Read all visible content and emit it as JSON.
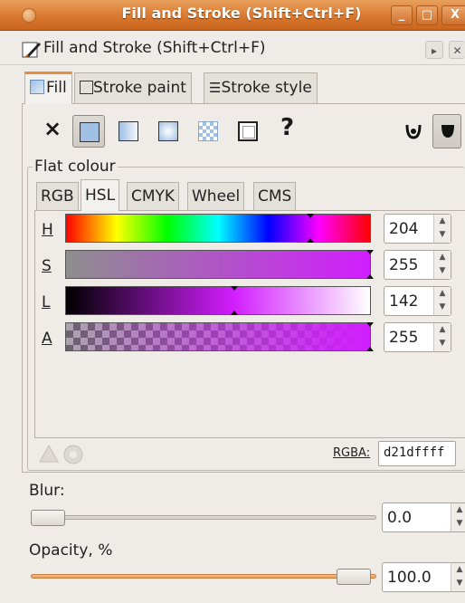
{
  "window": {
    "title": "Fill and Stroke (Shift+Ctrl+F)",
    "buttons": [
      "_",
      "□",
      "X"
    ]
  },
  "dock": {
    "title": "Fill and Stroke (Shift+Ctrl+F)"
  },
  "tabs": [
    {
      "label": "Fill",
      "active": true
    },
    {
      "label": "Stroke paint",
      "active": false
    },
    {
      "label": "Stroke style",
      "active": false
    }
  ],
  "paint_types": [
    {
      "icon": "no-paint-icon",
      "glyph": "×"
    },
    {
      "icon": "flat-color-icon",
      "selected": true
    },
    {
      "icon": "linear-gradient-icon"
    },
    {
      "icon": "radial-gradient-icon"
    },
    {
      "icon": "pattern-icon"
    },
    {
      "icon": "swatch-icon"
    },
    {
      "icon": "unset-paint-icon",
      "glyph": "?"
    }
  ],
  "fill_rule": {
    "evenodd": "evenodd-icon",
    "nonzero": "nonzero-icon"
  },
  "frame": {
    "label": "Flat colour"
  },
  "color_tabs": [
    {
      "label": "RGB"
    },
    {
      "label": "HSL",
      "active": true
    },
    {
      "label": "CMYK"
    },
    {
      "label": "Wheel"
    },
    {
      "label": "CMS"
    }
  ],
  "channels": [
    {
      "label": "H",
      "value": "204"
    },
    {
      "label": "S",
      "value": "255"
    },
    {
      "label": "L",
      "value": "142"
    },
    {
      "label": "A",
      "value": "255"
    }
  ],
  "color": {
    "hex": "#d21dff",
    "accent": "#e58d3c"
  },
  "rgba": {
    "label": "RGBA:",
    "value": "d21dffff"
  },
  "blur": {
    "label": "Blur:",
    "value": "0.0",
    "level": 0
  },
  "opacity": {
    "label": "Opacity, %",
    "value": "100.0",
    "level": 100
  }
}
